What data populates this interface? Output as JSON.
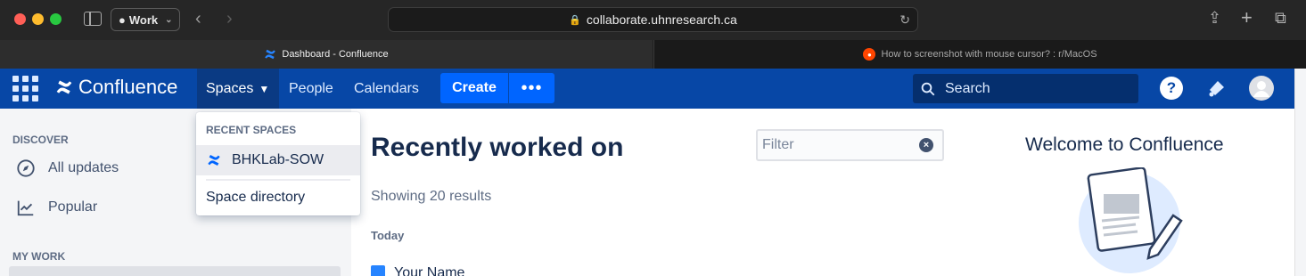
{
  "browser": {
    "profile_label": "Work",
    "url": "collaborate.uhnresearch.ca",
    "tabs": [
      {
        "title": "Dashboard - Confluence",
        "active": true
      },
      {
        "title": "How to screenshot with mouse cursor? : r/MacOS",
        "active": false
      }
    ]
  },
  "header": {
    "logo_text": "Confluence",
    "nav": {
      "spaces": "Spaces",
      "people": "People",
      "calendars": "Calendars"
    },
    "create_label": "Create",
    "more_label": "•••",
    "search_placeholder": "Search",
    "help_label": "?"
  },
  "sidebar": {
    "discover_heading": "DISCOVER",
    "items": [
      {
        "label": "All updates",
        "icon": "compass-icon"
      },
      {
        "label": "Popular",
        "icon": "trending-icon"
      }
    ],
    "my_work_heading": "MY WORK"
  },
  "dropdown": {
    "heading": "RECENT SPACES",
    "recent_space": "BHKLab-SOW",
    "directory_label": "Space directory"
  },
  "main": {
    "title": "Recently worked on",
    "results_text": "Showing 20 results",
    "section_today": "Today",
    "first_item": "Your Name",
    "filter_placeholder": "Filter",
    "welcome_title": "Welcome to Confluence"
  },
  "colors": {
    "header_bg": "#0747a6",
    "create_button": "#0065ff",
    "sidebar_bg": "#f4f5f7",
    "title_text": "#172b4d"
  }
}
